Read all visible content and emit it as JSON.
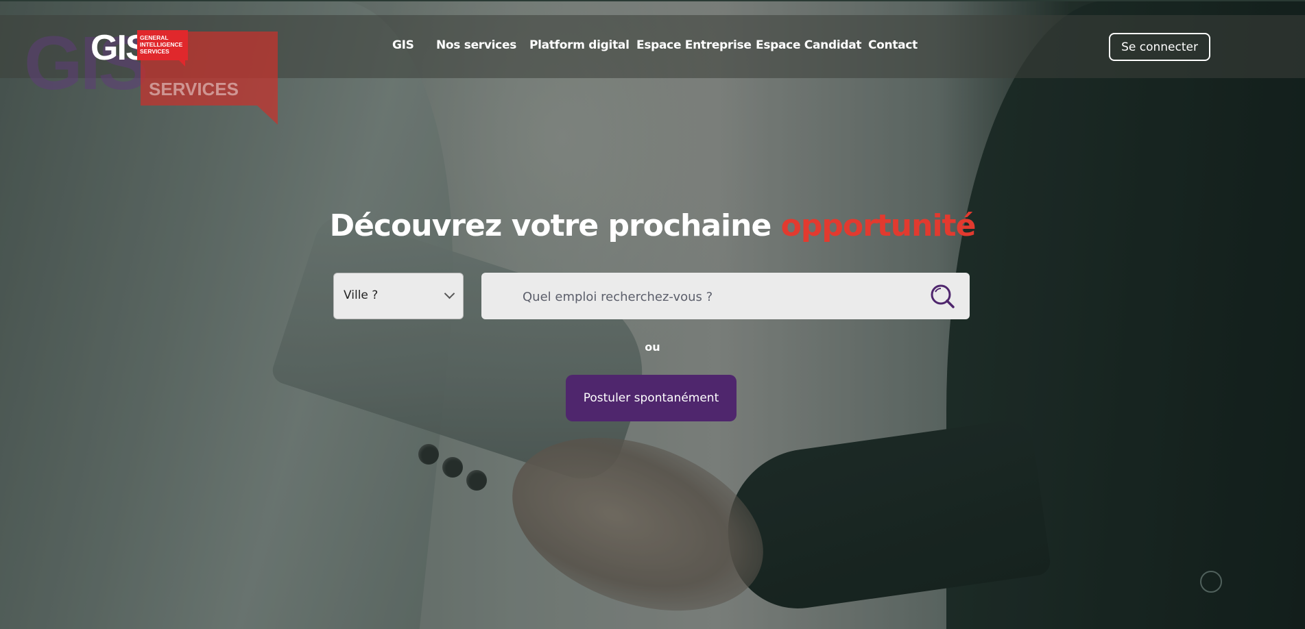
{
  "brand": {
    "logo_letters": "GIS",
    "logo_tag": "GENERAL\nINTELLIGENCE\nSERVICES",
    "ghost_tag": "SERVICES",
    "colors": {
      "purple": "#4f266d",
      "red": "#e0282c",
      "accent_text": "#e23a2f"
    }
  },
  "nav": {
    "items": [
      {
        "label": "GIS"
      },
      {
        "label": "Nos services"
      },
      {
        "label": "Platform digital"
      },
      {
        "label": "Espace Entreprise"
      },
      {
        "label": "Espace Candidat"
      },
      {
        "label": "Contact"
      }
    ],
    "login_label": "Se connecter"
  },
  "hero": {
    "headline_main": "Découvrez votre prochaine",
    "headline_accent": "opportunité",
    "city_select": {
      "selected": "Ville ?"
    },
    "search": {
      "placeholder": "Quel emploi recherchez-vous ?",
      "icon": "search-icon"
    },
    "or_label": "ou",
    "apply_label": "Postuler spontanément"
  }
}
